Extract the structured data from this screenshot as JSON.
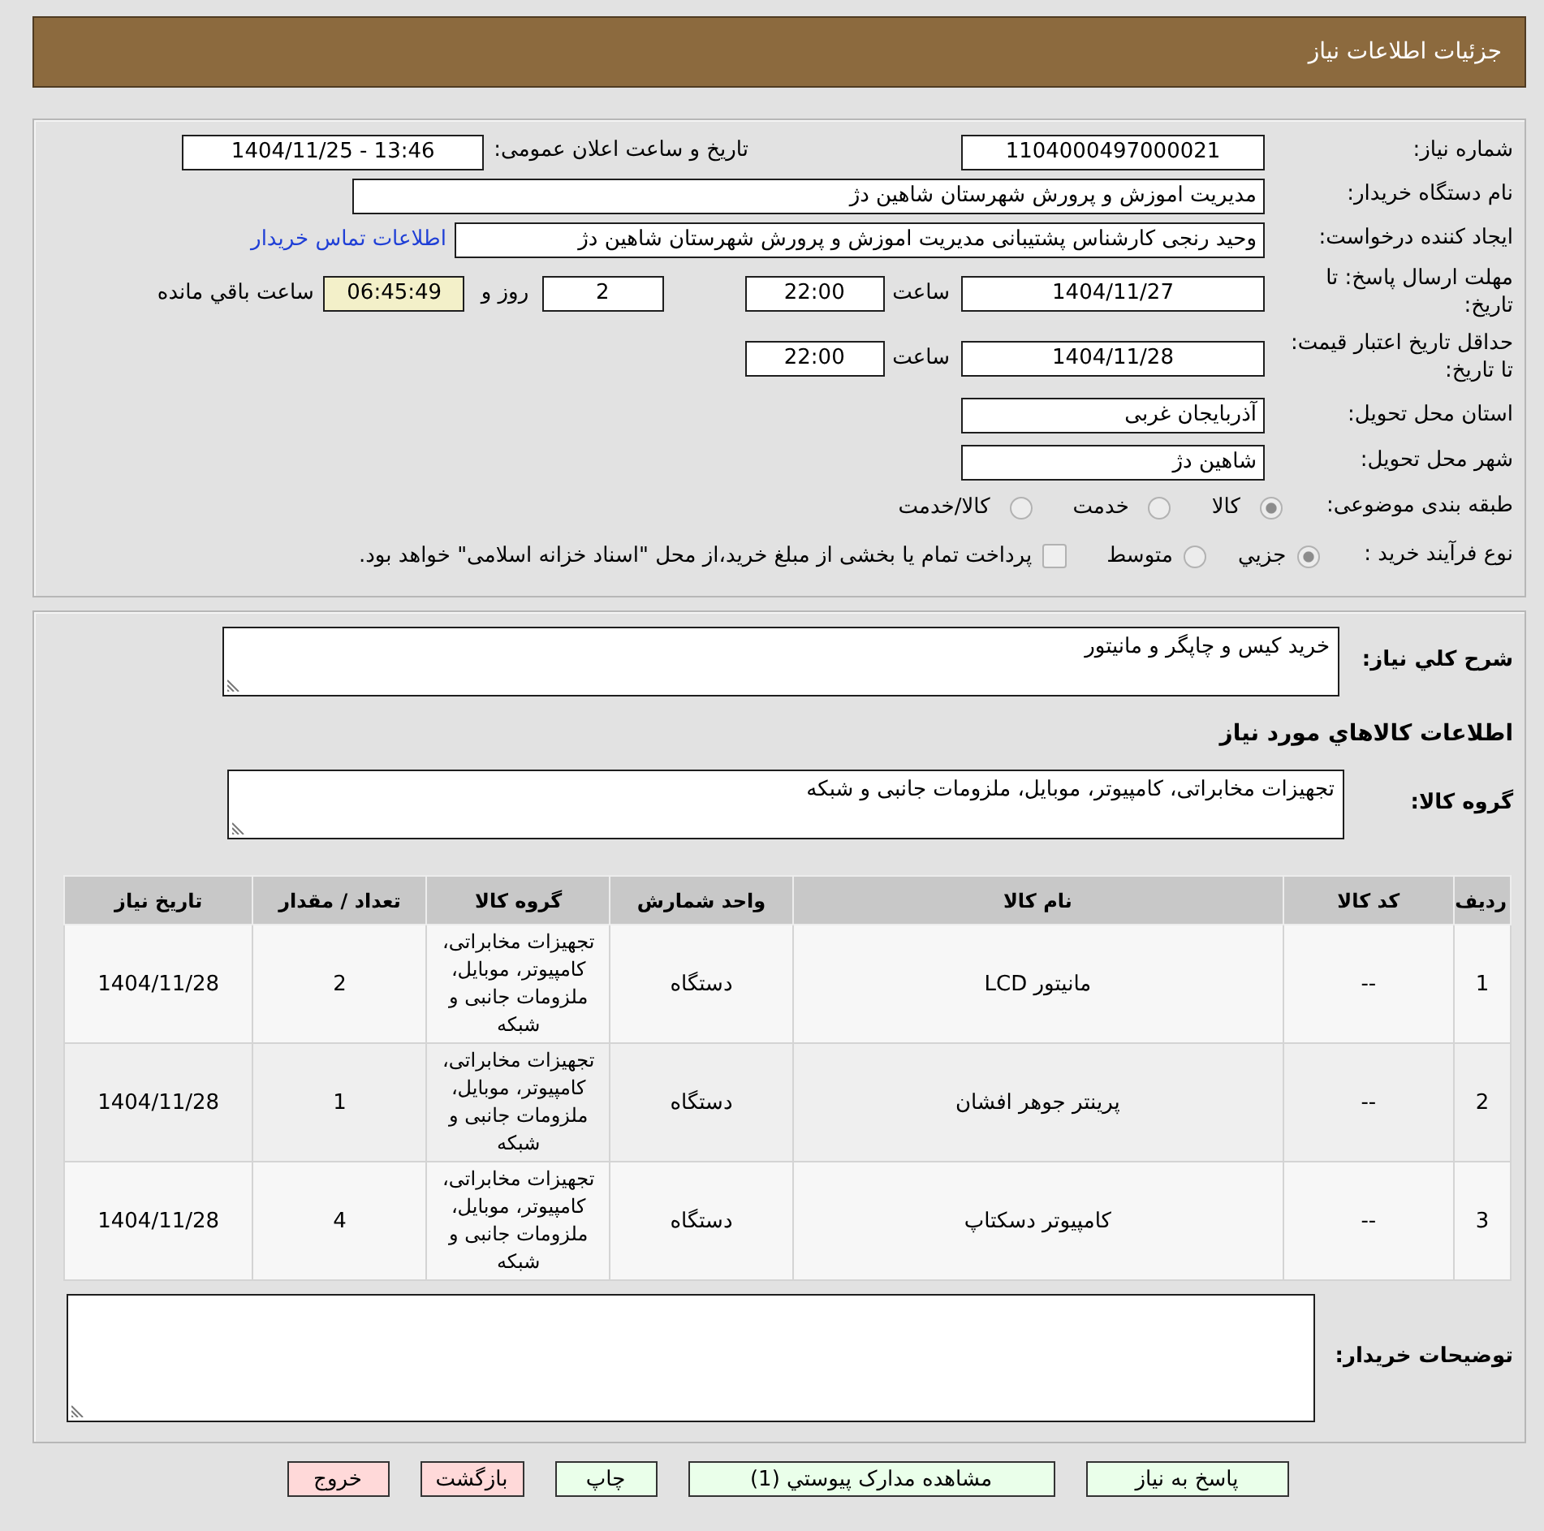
{
  "header": {
    "title": "جزئیات اطلاعات نیاز"
  },
  "details": {
    "need_number": {
      "label": "شماره نیاز:",
      "value": "1104000497000021"
    },
    "announcement": {
      "label": "تاریخ و ساعت اعلان عمومی:",
      "value": "1404/11/25 - 13:46"
    },
    "buyer_org": {
      "label": "نام دستگاه خریدار:",
      "value": "مدیریت اموزش و پرورش شهرستان شاهین دژ"
    },
    "requester": {
      "label": "ایجاد کننده درخواست:",
      "value": "وحید رنجی کارشناس پشتیبانی مدیریت اموزش و پرورش شهرستان شاهین دژ",
      "link": "اطلاعات تماس خریدار"
    },
    "response_deadline": {
      "label": "مهلت ارسال پاسخ: تا تاریخ:",
      "date": "1404/11/27",
      "time_label": "ساعت",
      "time": "22:00",
      "days": "2",
      "days_label": "روز و",
      "remaining": "06:45:49",
      "remaining_label": "ساعت باقي مانده"
    },
    "price_validity": {
      "label": "حداقل تاریخ اعتبار قیمت: تا تاریخ:",
      "date": "1404/11/28",
      "time_label": "ساعت",
      "time": "22:00"
    },
    "province": {
      "label": "استان محل تحویل:",
      "value": "آذربایجان غربی"
    },
    "city": {
      "label": "شهر محل تحویل:",
      "value": "شاهین دژ"
    },
    "category": {
      "label": "طبقه بندی موضوعی:",
      "options": [
        {
          "label": "کالا",
          "selected": true
        },
        {
          "label": "خدمت",
          "selected": false
        },
        {
          "label": "کالا/خدمت",
          "selected": false
        }
      ]
    },
    "purchase_process": {
      "label": "نوع فرآیند خرید :",
      "options": [
        {
          "label": "جزيي",
          "selected": true
        },
        {
          "label": "متوسط",
          "selected": false
        }
      ],
      "treasury_option": {
        "label": "پرداخت تمام یا بخشی از مبلغ خرید،از محل \"اسناد خزانه اسلامی\" خواهد بود.",
        "checked": false
      }
    }
  },
  "needs": {
    "description": {
      "label": "شرح کلي نیاز:",
      "value": "خرید کیس و چاپگر و مانیتور"
    },
    "goods_heading": "اطلاعات کالاهاي مورد نیاز",
    "goods_group": {
      "label": "گروه کالا:",
      "value": "تجهیزات مخابراتی، کامپیوتر، موبایل، ملزومات جانبی و شبکه"
    },
    "table": {
      "columns": [
        "ردیف",
        "کد کالا",
        "نام کالا",
        "واحد شمارش",
        "گروه کالا",
        "تعداد / مقدار",
        "تاریخ نیاز"
      ],
      "rows": [
        [
          "1",
          "--",
          "مانیتور LCD",
          "دستگاه",
          "تجهیزات مخابراتی، کامپیوتر، موبایل، ملزومات جانبی و شبکه",
          "2",
          "1404/11/28"
        ],
        [
          "2",
          "--",
          "پرینتر جوهر افشان",
          "دستگاه",
          "تجهیزات مخابراتی، کامپیوتر، موبایل، ملزومات جانبی و شبکه",
          "1",
          "1404/11/28"
        ],
        [
          "3",
          "--",
          "کامپیوتر دسکتاپ",
          "دستگاه",
          "تجهیزات مخابراتی، کامپیوتر، موبایل، ملزومات جانبی و شبکه",
          "4",
          "1404/11/28"
        ]
      ]
    },
    "buyer_notes": {
      "label": "توضیحات خریدار:"
    }
  },
  "buttons": [
    {
      "label": "پاسخ به نیاز",
      "kind": "action"
    },
    {
      "label": "مشاهده مدارک پیوستي (1)",
      "kind": "action"
    },
    {
      "label": "چاپ",
      "kind": "action"
    },
    {
      "label": "بازگشت",
      "kind": "exit"
    },
    {
      "label": "خروج",
      "kind": "exit"
    }
  ]
}
